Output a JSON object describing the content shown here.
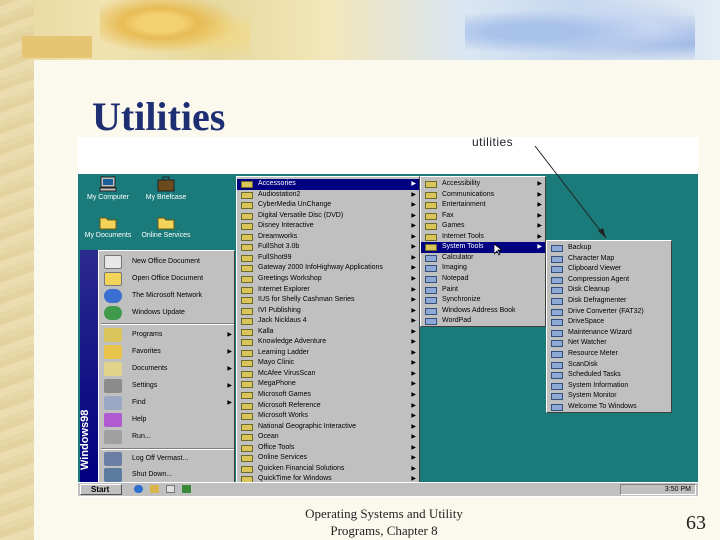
{
  "slide": {
    "title": "Utilities",
    "footer_line1": "Operating Systems and Utility",
    "footer_line2": "Programs,  Chapter 8",
    "page_number": "63",
    "callout": "utilities"
  },
  "desktop": {
    "icons": [
      {
        "label": "My Computer",
        "icon": "computer-icon"
      },
      {
        "label": "My Briefcase",
        "icon": "briefcase-icon"
      },
      {
        "label": "My Documents",
        "icon": "folder-icon"
      },
      {
        "label": "Online Services",
        "icon": "folder-icon"
      }
    ],
    "background_color": "#1b7a7a"
  },
  "taskbar": {
    "start_label": "Start",
    "clock": "3:50 PM"
  },
  "start_menu": {
    "banner": "Windows98",
    "top_items": [
      {
        "label": "New Office Document",
        "icon": "office-doc-icon"
      },
      {
        "label": "Open Office Document",
        "icon": "office-open-icon"
      },
      {
        "label": "The Microsoft Network",
        "icon": "msn-icon"
      },
      {
        "label": "Windows Update",
        "icon": "globe-icon"
      }
    ],
    "main_items": [
      {
        "label": "Programs",
        "icon": "programs-icon",
        "submenu": true
      },
      {
        "label": "Favorites",
        "icon": "favorites-icon",
        "submenu": true
      },
      {
        "label": "Documents",
        "icon": "documents-icon",
        "submenu": true
      },
      {
        "label": "Settings",
        "icon": "settings-icon",
        "submenu": true
      },
      {
        "label": "Find",
        "icon": "find-icon",
        "submenu": true
      },
      {
        "label": "Help",
        "icon": "help-icon",
        "submenu": false
      },
      {
        "label": "Run...",
        "icon": "run-icon",
        "submenu": false
      }
    ],
    "bottom_items": [
      {
        "label": "Log Off Vermast...",
        "icon": "logoff-icon"
      },
      {
        "label": "Shut Down...",
        "icon": "shutdown-icon"
      }
    ]
  },
  "programs_menu": {
    "items": [
      {
        "label": "Accessories",
        "submenu": true,
        "selected": true
      },
      {
        "label": "Audiostation2",
        "submenu": true
      },
      {
        "label": "CyberMedia UnChange",
        "submenu": true
      },
      {
        "label": "Digital Versatile Disc (DVD)",
        "submenu": true
      },
      {
        "label": "Disney Interactive",
        "submenu": true
      },
      {
        "label": "Dreamworks",
        "submenu": true
      },
      {
        "label": "FullShot 3.0b",
        "submenu": true
      },
      {
        "label": "FullShot99",
        "submenu": true
      },
      {
        "label": "Gateway 2000 InfoHighway Applications",
        "submenu": true
      },
      {
        "label": "Greetings Workshop",
        "submenu": true
      },
      {
        "label": "Internet Explorer",
        "submenu": true
      },
      {
        "label": "IUS for Shelly Cashman Series",
        "submenu": true
      },
      {
        "label": "IVI Publishing",
        "submenu": true
      },
      {
        "label": "Jack Nicklaus 4",
        "submenu": true
      },
      {
        "label": "Kalla",
        "submenu": true
      },
      {
        "label": "Knowledge Adventure",
        "submenu": true
      },
      {
        "label": "Learning Ladder",
        "submenu": true
      },
      {
        "label": "Mayo Clinic",
        "submenu": true
      },
      {
        "label": "McAfee VirusScan",
        "submenu": true
      },
      {
        "label": "MegaPhone",
        "submenu": true
      },
      {
        "label": "Microsoft Games",
        "submenu": true
      },
      {
        "label": "Microsoft Reference",
        "submenu": true
      },
      {
        "label": "Microsoft Works",
        "submenu": true
      },
      {
        "label": "National Geographic Interactive",
        "submenu": true
      },
      {
        "label": "Ocean",
        "submenu": true
      },
      {
        "label": "Office Tools",
        "submenu": true
      },
      {
        "label": "Online Services",
        "submenu": true
      },
      {
        "label": "Quicken Financial Solutions",
        "submenu": true
      },
      {
        "label": "QuickTime for Windows",
        "submenu": true
      }
    ]
  },
  "accessories_menu": {
    "items": [
      {
        "label": "Accessibility",
        "submenu": true
      },
      {
        "label": "Communications",
        "submenu": true
      },
      {
        "label": "Entertainment",
        "submenu": true
      },
      {
        "label": "Fax",
        "submenu": true
      },
      {
        "label": "Games",
        "submenu": true
      },
      {
        "label": "Internet Tools",
        "submenu": true
      },
      {
        "label": "System Tools",
        "submenu": true,
        "selected": true
      },
      {
        "label": "Calculator",
        "submenu": false
      },
      {
        "label": "Imaging",
        "submenu": false
      },
      {
        "label": "Notepad",
        "submenu": false
      },
      {
        "label": "Paint",
        "submenu": false
      },
      {
        "label": "Synchronize",
        "submenu": false
      },
      {
        "label": "Windows Address Book",
        "submenu": false
      },
      {
        "label": "WordPad",
        "submenu": false
      }
    ]
  },
  "system_tools_menu": {
    "items": [
      {
        "label": "Backup"
      },
      {
        "label": "Character Map"
      },
      {
        "label": "Clipboard Viewer"
      },
      {
        "label": "Compression Agent"
      },
      {
        "label": "Disk Cleanup"
      },
      {
        "label": "Disk Defragmenter"
      },
      {
        "label": "Drive Converter (FAT32)"
      },
      {
        "label": "DriveSpace"
      },
      {
        "label": "Maintenance Wizard"
      },
      {
        "label": "Net Watcher"
      },
      {
        "label": "Resource Meter"
      },
      {
        "label": "ScanDisk"
      },
      {
        "label": "Scheduled Tasks"
      },
      {
        "label": "System Information"
      },
      {
        "label": "System Monitor"
      },
      {
        "label": "Welcome To Windows"
      }
    ]
  }
}
